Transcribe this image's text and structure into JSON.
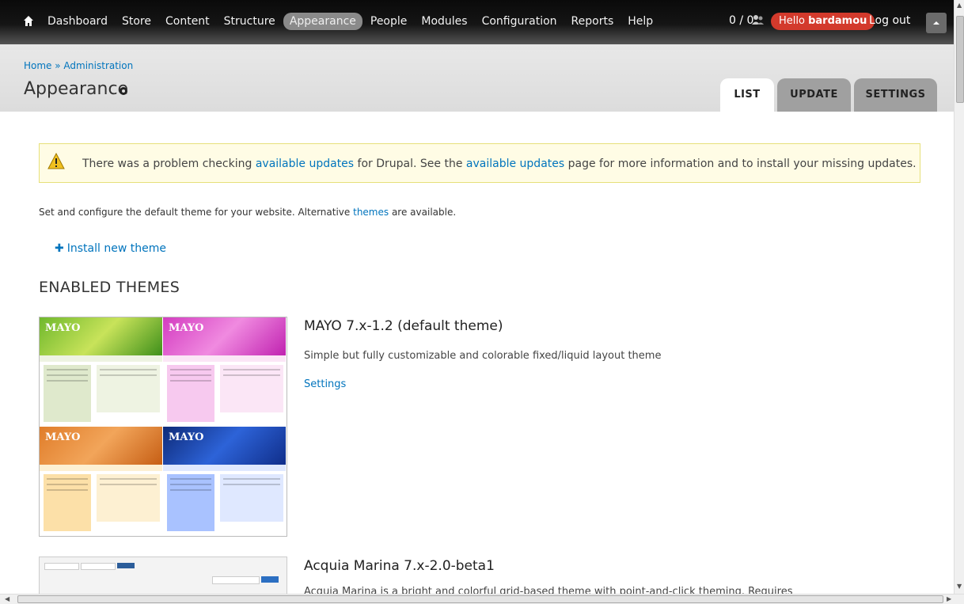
{
  "toolbar": {
    "menu": [
      "Dashboard",
      "Store",
      "Content",
      "Structure",
      "Appearance",
      "People",
      "Modules",
      "Configuration",
      "Reports",
      "Help"
    ],
    "active_menu": "Appearance",
    "counter": "0 / 0",
    "hello_prefix": "Hello",
    "username": "bardamou",
    "logout": "Log out"
  },
  "header": {
    "breadcrumb": "Home » Administration",
    "title": "Appearance",
    "tabs": [
      "LIST",
      "UPDATE",
      "SETTINGS"
    ],
    "active_tab": "LIST"
  },
  "warning": {
    "pre": "There was a problem checking ",
    "link1": "available updates",
    "mid": " for Drupal. See the ",
    "link2": "available updates",
    "post": " page for more information and to install your missing updates."
  },
  "intro": {
    "pre": "Set and configure the default theme for your website. Alternative ",
    "link": "themes",
    "post": " are available."
  },
  "install_link": "Install new theme",
  "enabled_heading": "ENABLED THEMES",
  "themes": [
    {
      "name": "MAYO 7.x-1.2 (default theme)",
      "description": "Simple but fully customizable and colorable fixed/liquid layout theme",
      "settings": "Settings",
      "preview_logo": "MAYO"
    },
    {
      "name": "Acquia Marina 7.x-2.0-beta1",
      "description": "Acquia Marina is a bright and colorful grid-based theme with point-and-click theming. Requires"
    }
  ],
  "colors": {
    "toolbar_bg": "#111111",
    "hello_badge": "#d33a2c",
    "link": "#0074bd",
    "warning_bg": "#fffce5"
  }
}
